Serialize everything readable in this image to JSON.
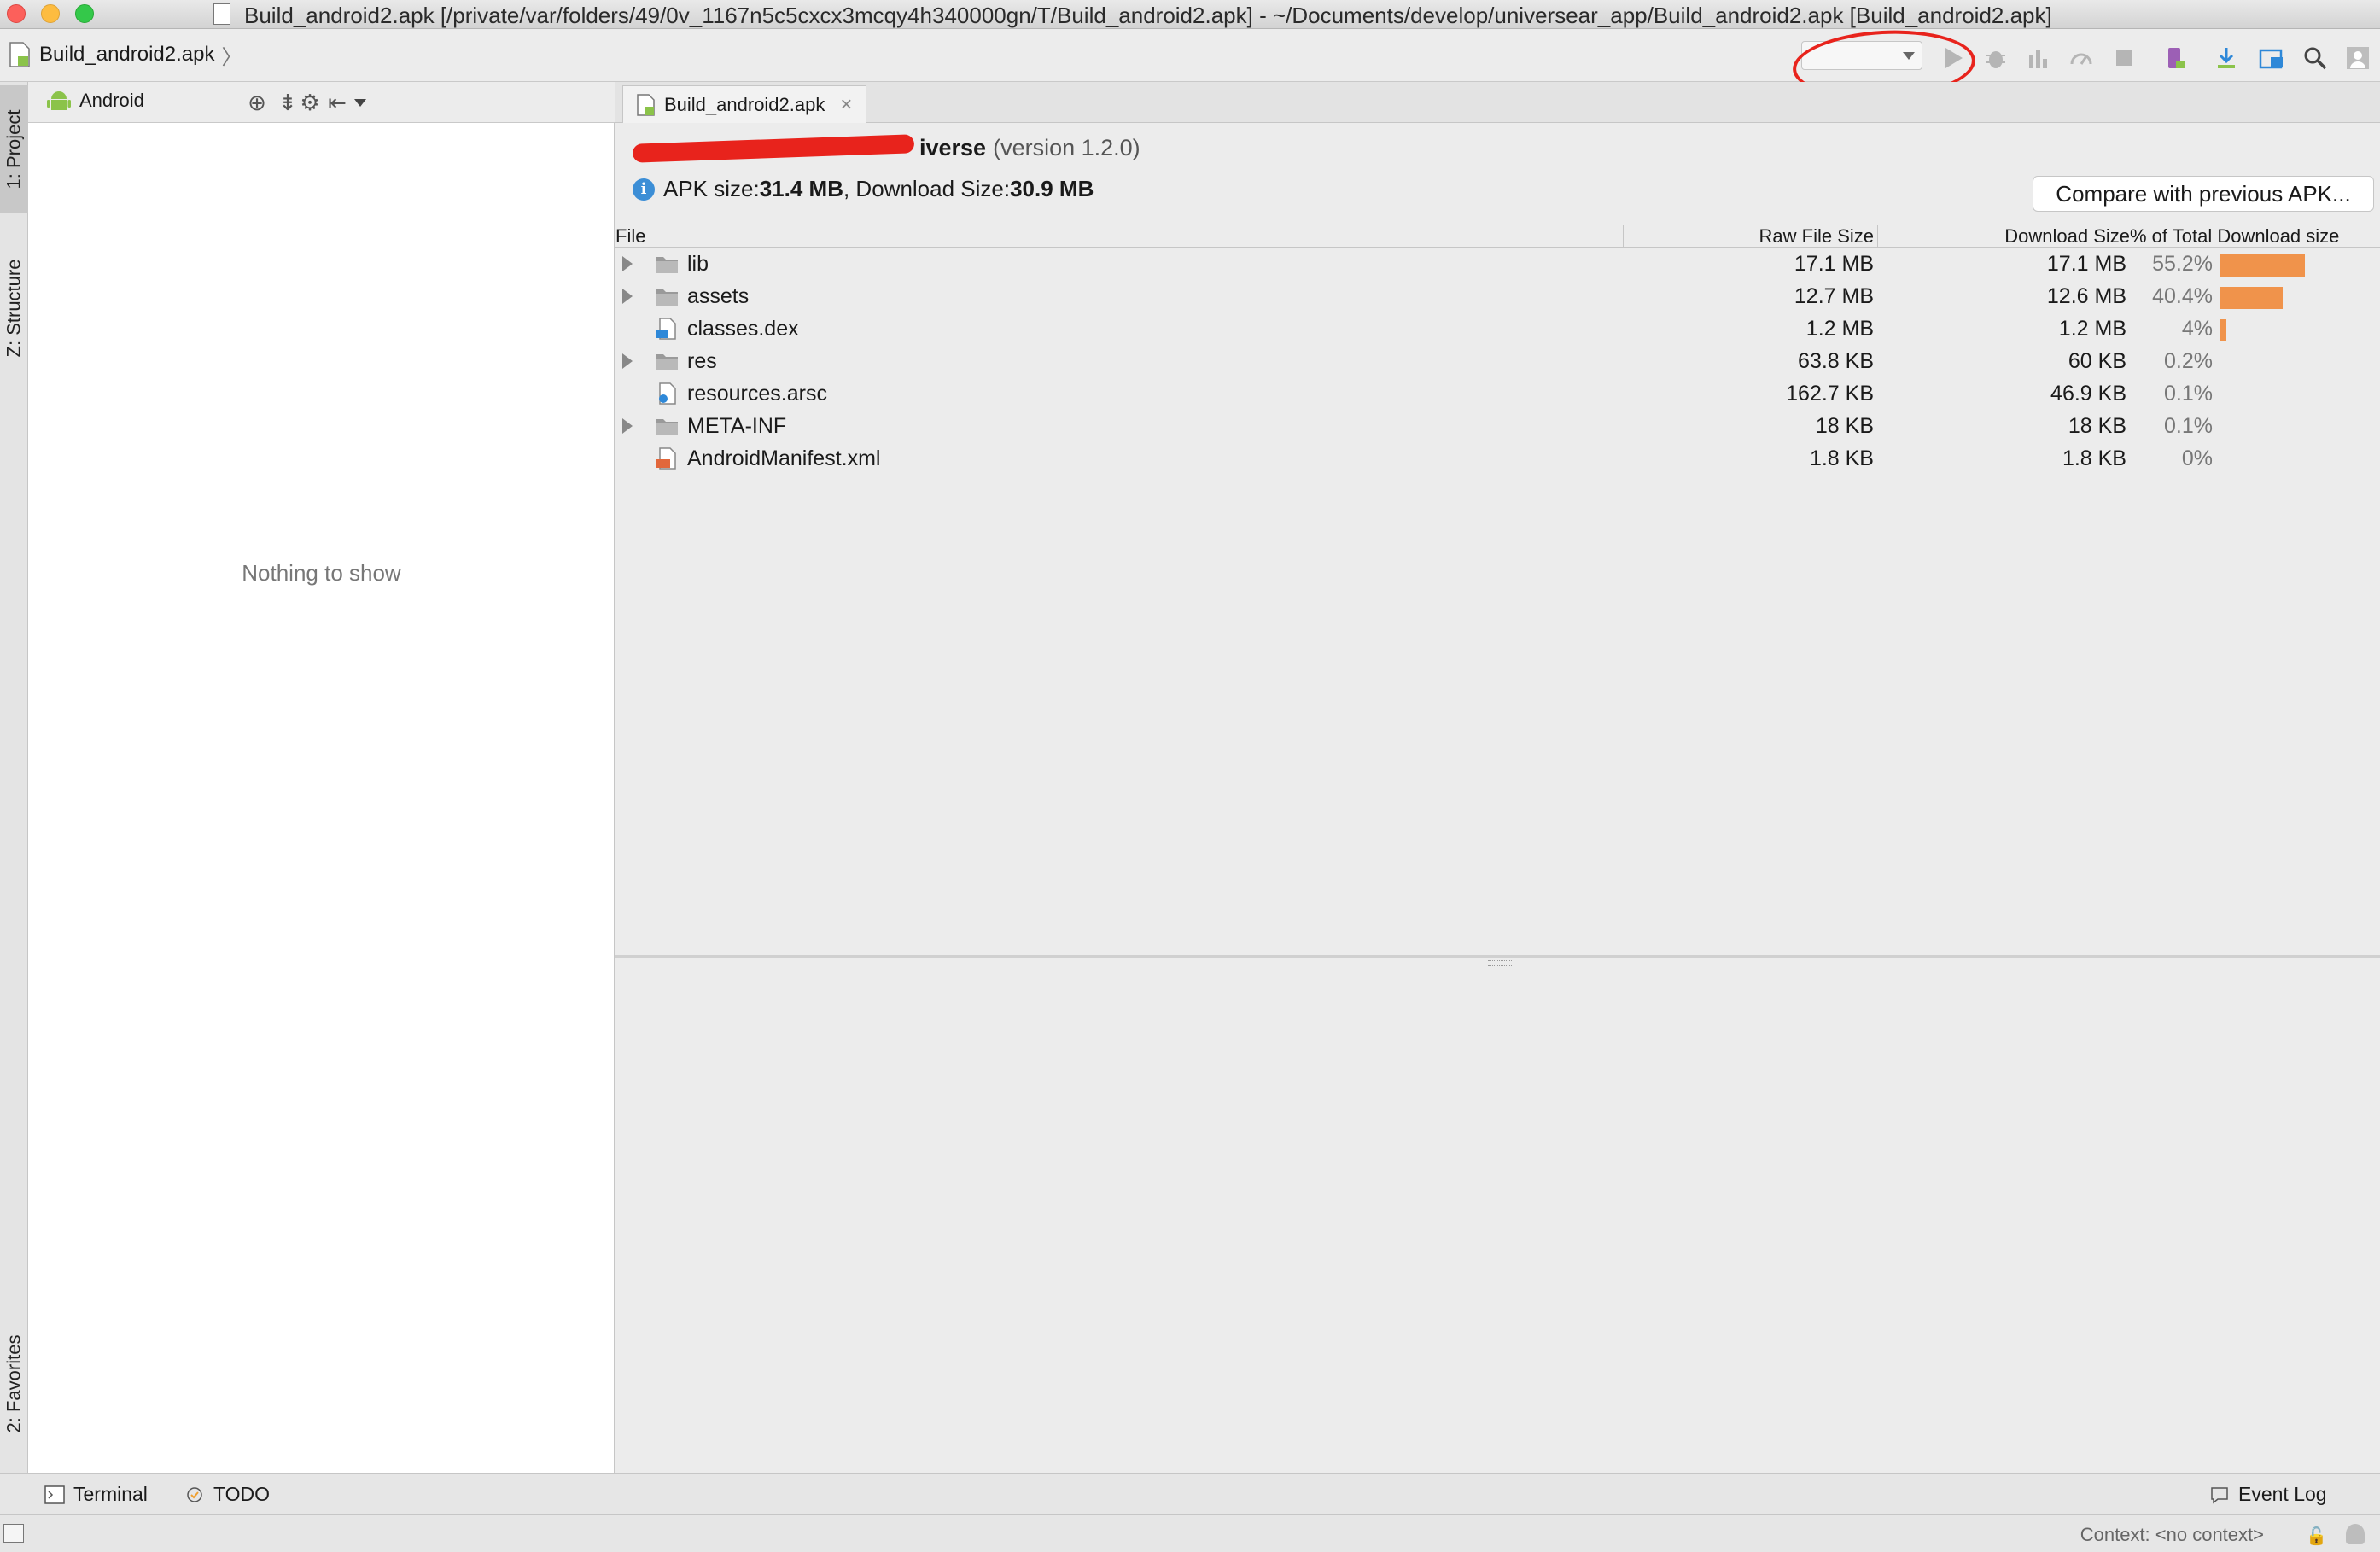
{
  "window": {
    "title": "Build_android2.apk [/private/var/folders/49/0v_1167n5c5cxcx3mcqy4h340000gn/T/Build_android2.apk] - ~/Documents/develop/universear_app/Build_android2.apk [Build_android2.apk]"
  },
  "navbar": {
    "breadcrumb": "Build_android2.apk",
    "run_config": ""
  },
  "left_stripe": {
    "project_tab": "1: Project",
    "structure_tab": "Z: Structure",
    "favorites_tab": "2: Favorites"
  },
  "project_panel": {
    "view_mode": "Android",
    "empty_text": "Nothing to show"
  },
  "editor": {
    "tab_label": "Build_android2.apk",
    "app_name_visible": "iverse",
    "version_text": "(version 1.2.0)",
    "apk_size_label": "APK size: ",
    "apk_size_value": "31.4 MB",
    "download_size_label": ", Download Size: ",
    "download_size_value": "30.9 MB",
    "compare_button": "Compare with previous APK..."
  },
  "table": {
    "headers": {
      "file": "File",
      "raw": "Raw File Size",
      "download": "Download Size",
      "percent": "% of Total Download size"
    },
    "rows": [
      {
        "name": "lib",
        "type": "folder",
        "raw": "17.1 MB",
        "download": "17.1 MB",
        "percent": "55.2%",
        "fraction": 0.552
      },
      {
        "name": "assets",
        "type": "folder",
        "raw": "12.7 MB",
        "download": "12.6 MB",
        "percent": "40.4%",
        "fraction": 0.404
      },
      {
        "name": "classes.dex",
        "type": "dex",
        "raw": "1.2 MB",
        "download": "1.2 MB",
        "percent": "4%",
        "fraction": 0.04
      },
      {
        "name": "res",
        "type": "folder",
        "raw": "63.8 KB",
        "download": "60 KB",
        "percent": "0.2%",
        "fraction": 0.002
      },
      {
        "name": "resources.arsc",
        "type": "arsc",
        "raw": "162.7 KB",
        "download": "46.9 KB",
        "percent": "0.1%",
        "fraction": 0.001
      },
      {
        "name": "META-INF",
        "type": "folder",
        "raw": "18 KB",
        "download": "18 KB",
        "percent": "0.1%",
        "fraction": 0.001
      },
      {
        "name": "AndroidManifest.xml",
        "type": "xml",
        "raw": "1.8 KB",
        "download": "1.8 KB",
        "percent": "0%",
        "fraction": 0
      }
    ]
  },
  "bottom_bar": {
    "terminal": "Terminal",
    "todo": "TODO",
    "event_log": "Event Log"
  },
  "status": {
    "context": "Context: <no context>"
  },
  "colors": {
    "bar": "#f0934b",
    "annotation_red": "#e8231c",
    "info_blue": "#3c8ed6"
  }
}
